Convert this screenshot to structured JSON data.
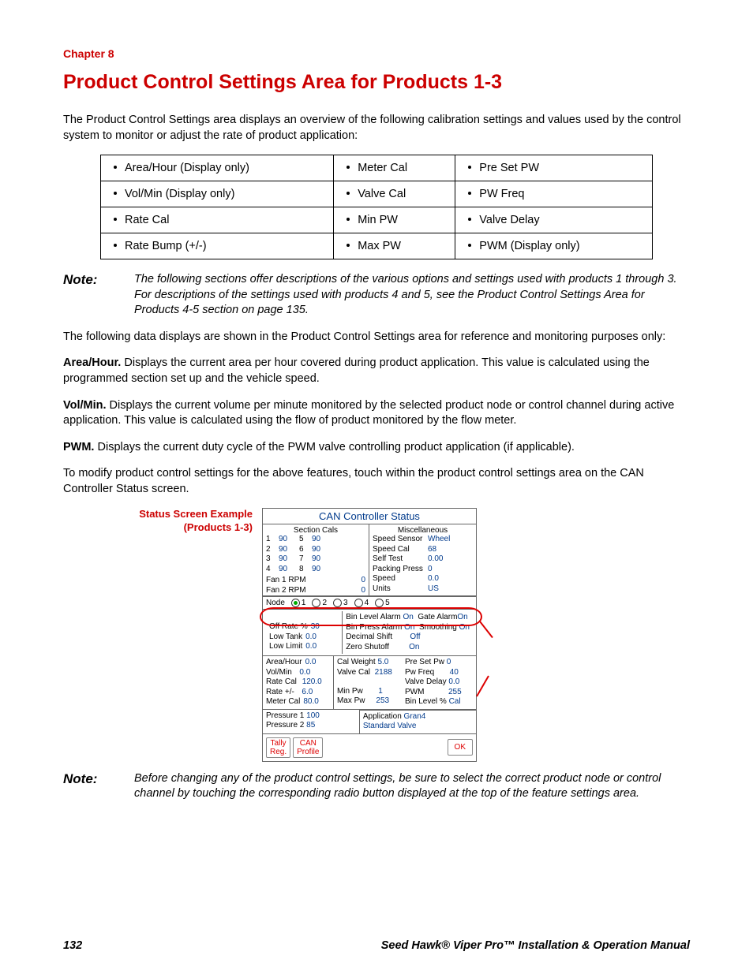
{
  "chapter": "Chapter 8",
  "heading": "Product Control Settings Area for Products 1-3",
  "intro": "The Product Control Settings area displays an overview of the following calibration settings and values used by the control system to monitor or adjust the rate of product application:",
  "settings_grid": [
    [
      "Area/Hour (Display only)",
      "Meter Cal",
      "Pre Set PW"
    ],
    [
      "Vol/Min (Display only)",
      "Valve Cal",
      "PW Freq"
    ],
    [
      "Rate Cal",
      "Min PW",
      "Valve Delay"
    ],
    [
      "Rate Bump (+/-)",
      "Max PW",
      "PWM (Display only)"
    ]
  ],
  "note1_label": "Note:",
  "note1": "The following sections offer descriptions of the various options and settings used with products 1 through 3. For descriptions of the settings used with products 4 and 5, see the Product Control Settings Area for Products 4-5 section on page 135.",
  "para2": "The following data displays are shown in the Product Control Settings area for reference and monitoring purposes only:",
  "def_area_label": "Area/Hour.",
  "def_area": "Displays the current area per hour covered during product application. This value is calculated using the programmed section set up and the vehicle speed.",
  "def_vol_label": "Vol/Min.",
  "def_vol": "Displays the current volume per minute monitored by the selected product node or control channel during active application. This value is calculated using the flow of product monitored by the flow meter.",
  "def_pwm_label": "PWM.",
  "def_pwm": "Displays the current duty cycle of the PWM valve controlling product application (if applicable).",
  "para3": "To modify product control settings for the above features, touch within the product control settings area on the CAN Controller Status screen.",
  "side_label_1": "Status Screen Example",
  "side_label_2": "(Products 1-3)",
  "shot": {
    "title": "CAN Controller Status",
    "section_cals_hdr": "Section Cals",
    "misc_hdr": "Miscellaneous",
    "sections": [
      {
        "n": "1",
        "v": "90"
      },
      {
        "n": "5",
        "v": "90"
      },
      {
        "n": "2",
        "v": "90"
      },
      {
        "n": "6",
        "v": "90"
      },
      {
        "n": "3",
        "v": "90"
      },
      {
        "n": "7",
        "v": "90"
      },
      {
        "n": "4",
        "v": "90"
      },
      {
        "n": "8",
        "v": "90"
      }
    ],
    "fan1_k": "Fan 1 RPM",
    "fan1_v": "0",
    "fan2_k": "Fan 2 RPM",
    "fan2_v": "0",
    "misc": [
      [
        "Speed Sensor",
        "Wheel"
      ],
      [
        "Speed Cal",
        "68"
      ],
      [
        "Self Test",
        "0.00"
      ],
      [
        "Packing Press",
        "0"
      ],
      [
        "Speed",
        "0.0"
      ],
      [
        "Units",
        "US"
      ]
    ],
    "node_label": "Node",
    "nodes": [
      "1",
      "2",
      "3",
      "4",
      "5"
    ],
    "mid_right": {
      "r1": [
        [
          "Bin Level Alarm",
          "On"
        ],
        [
          "Gate Alarm",
          "On"
        ]
      ],
      "r2": [
        [
          "Bin Press Alarm",
          "On"
        ],
        [
          "Smoothing",
          "On"
        ]
      ],
      "r3": [
        [
          "Decimal Shift",
          "Off"
        ]
      ],
      "r4": [
        [
          "Zero Shutoff",
          "On"
        ]
      ]
    },
    "mid_left": [
      [
        "Off Rate %",
        "30"
      ],
      [
        "Low Tank",
        "0.0"
      ],
      [
        "Low Limit",
        "0.0"
      ]
    ],
    "bottom_left": [
      [
        "Area/Hour",
        "0.0"
      ],
      [
        "Vol/Min",
        "0.0"
      ],
      [
        "Rate Cal",
        "120.0"
      ],
      [
        "Rate +/-",
        "6.0"
      ],
      [
        "Meter Cal",
        "80.0"
      ]
    ],
    "bottom_mid_top": [
      [
        "Cal Weight",
        "5.0"
      ],
      [
        "Valve Cal",
        "2188"
      ]
    ],
    "bottom_mid_top_right": [
      [
        "Pre Set Pw",
        "0"
      ],
      [
        "Pw Freq",
        "40"
      ],
      [
        "Valve Delay",
        "0.0"
      ],
      [
        "PWM",
        "255"
      ],
      [
        "Bin Level %",
        "Cal"
      ]
    ],
    "bottom_mid_bot": [
      [
        "Min Pw",
        "1"
      ],
      [
        "Max Pw",
        "253"
      ]
    ],
    "pressure": [
      [
        "Pressure 1",
        "100"
      ],
      [
        "Pressure 2",
        "85"
      ]
    ],
    "app_label": "Application",
    "app_val": "Gran4",
    "valve_label": "Standard Valve",
    "tally": "Tally\nReg.",
    "can_profile": "CAN\nProfile",
    "ok": "OK"
  },
  "note2_label": "Note:",
  "note2": "Before changing any of the product control settings, be sure to select the correct product node or control channel by touching the corresponding radio button displayed at the top of the feature settings area.",
  "page_no": "132",
  "footer": "Seed Hawk® Viper Pro™ Installation & Operation Manual"
}
